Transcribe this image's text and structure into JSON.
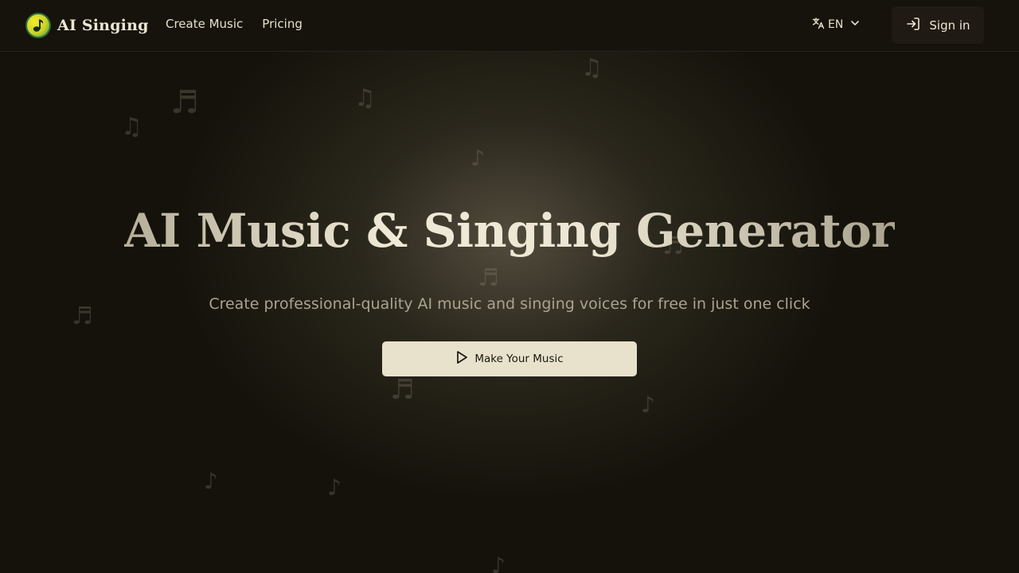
{
  "header": {
    "brand": "AI Singing",
    "logo_icon": "music-note-icon",
    "nav": [
      {
        "label": "Create Music"
      },
      {
        "label": "Pricing"
      }
    ],
    "language": {
      "label": "EN",
      "icon": "translate-icon"
    },
    "signin": {
      "label": "Sign in",
      "icon": "login-icon"
    }
  },
  "hero": {
    "title": "AI Music & Singing Generator",
    "subtitle": "Create professional-quality AI music and singing voices for free in just one click",
    "cta": {
      "label": "Make Your Music",
      "icon": "play-icon"
    }
  },
  "decor": {
    "note_glyph_single": "♪",
    "note_glyph_double": "♬",
    "note_glyph_beamed": "♫"
  },
  "colors": {
    "background": "#14120a",
    "cta_background": "#e8e2cd",
    "logo_yellow": "#f3ea2e",
    "logo_green": "#2a6a3a"
  }
}
